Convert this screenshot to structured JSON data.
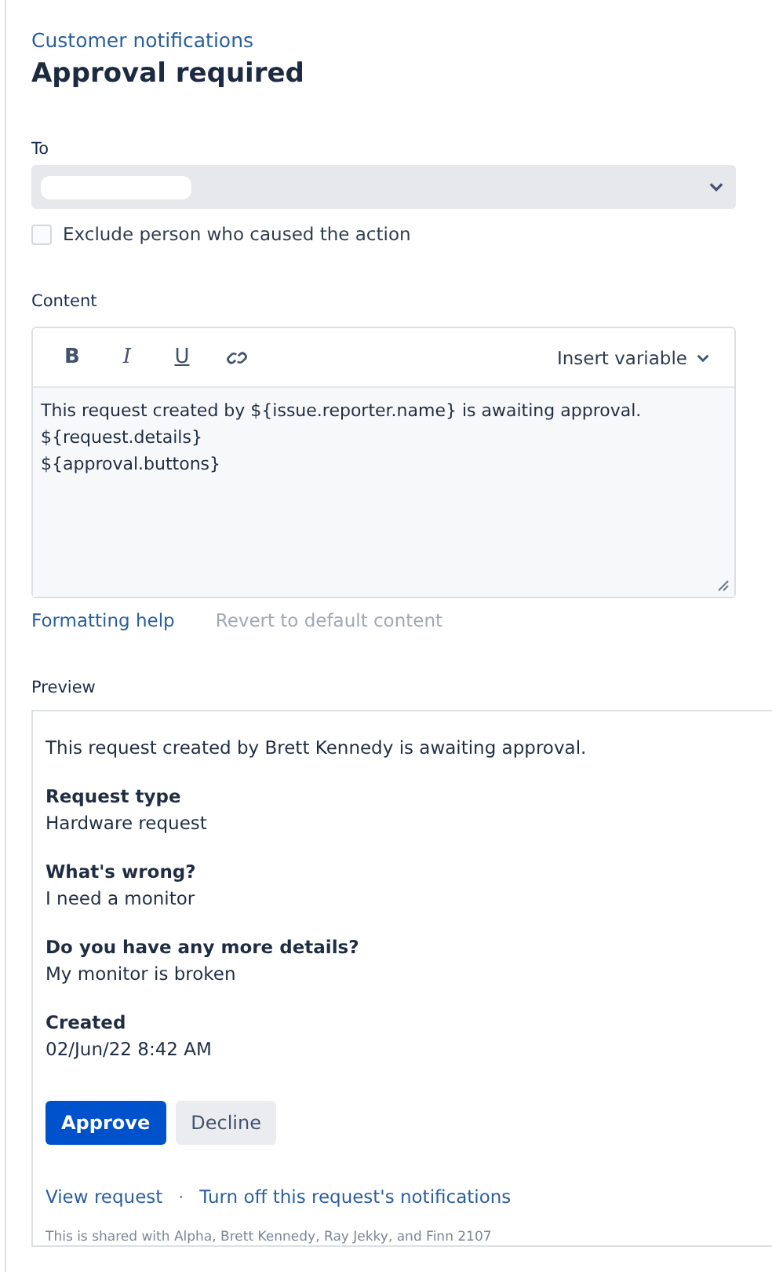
{
  "breadcrumb": "Customer notifications",
  "title": "Approval required",
  "to": {
    "label": "To",
    "redacted": true
  },
  "exclude": {
    "label": "Exclude person who caused the action",
    "checked": false
  },
  "content": {
    "label": "Content",
    "toolbar": [
      {
        "kind": "bold",
        "label": "B"
      },
      {
        "kind": "italic",
        "label": "I"
      },
      {
        "kind": "underline",
        "label": "U"
      },
      {
        "kind": "link"
      }
    ],
    "insert_variable": "Insert variable",
    "lines": [
      "This request created by ${issue.reporter.name} is awaiting approval.",
      "${request.details}",
      "${approval.buttons}"
    ]
  },
  "links": [
    {
      "label": "Formatting help",
      "disabled": false
    },
    {
      "label": "Revert to default content",
      "disabled": true
    }
  ],
  "preview": {
    "label": "Preview",
    "intro": "This request created by Brett Kennedy is awaiting approval.",
    "fields": [
      {
        "name": "Request type",
        "value": "Hardware request"
      },
      {
        "name": "What's wrong?",
        "value": "I need a monitor"
      },
      {
        "name": "Do you have any more details?",
        "value": "My monitor is broken"
      },
      {
        "name": "Created",
        "value": "02/Jun/22 8:42 AM"
      }
    ],
    "buttons": [
      {
        "label": "Approve",
        "kind": "primary"
      },
      {
        "label": "Decline",
        "kind": "secondary"
      }
    ],
    "footer_links": [
      "View request",
      "Turn off this request's notifications"
    ],
    "separator": "·",
    "shared": "This is shared with Alpha, Brett Kennedy, Ray Jekky, and Finn 2107"
  }
}
